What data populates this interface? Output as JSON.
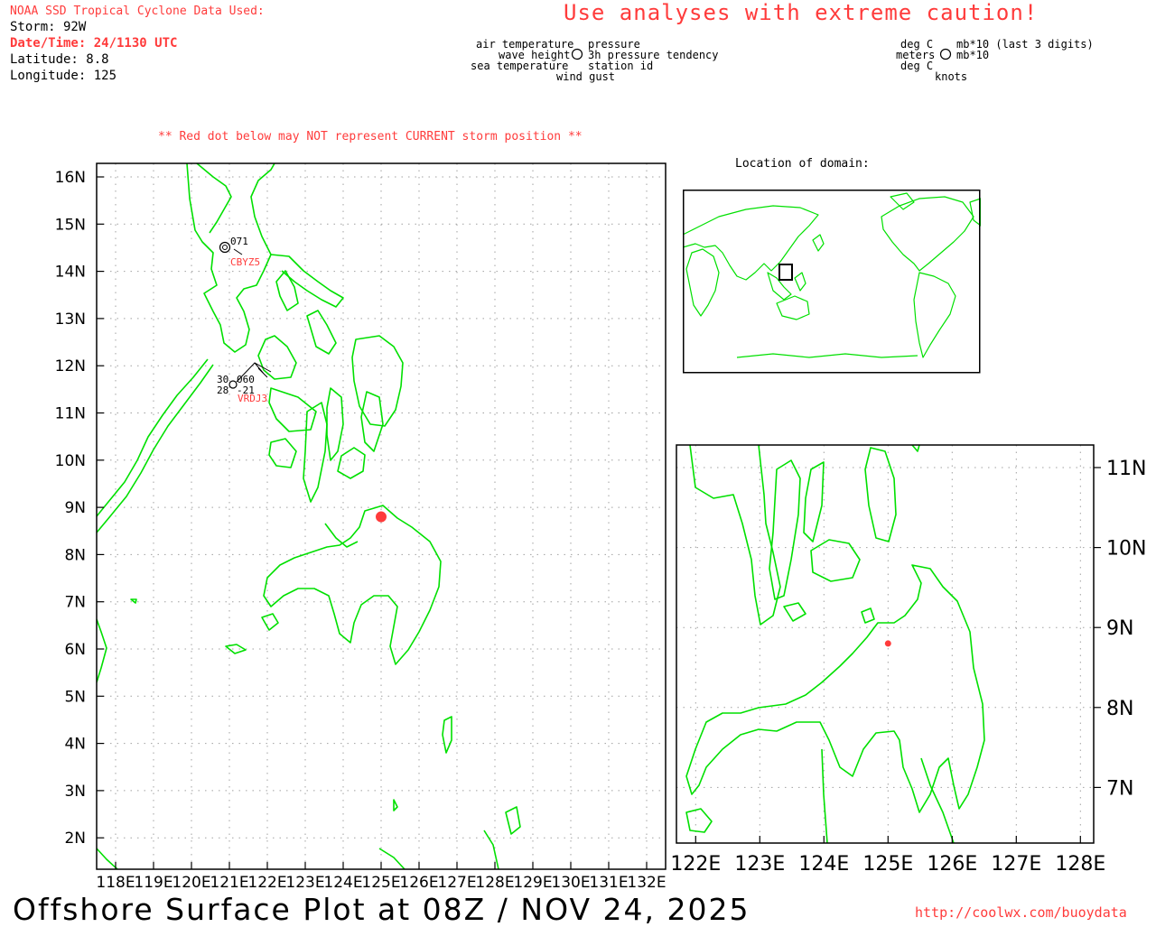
{
  "header": {
    "source_title": "NOAA SSD Tropical Cyclone Data Used:",
    "storm": "Storm: 92W",
    "datetime": "Date/Time: 24/1130 UTC",
    "latitude": "Latitude: 8.8",
    "longitude": "Longitude: 125",
    "caution": "Use analyses with extreme caution!",
    "red_dot_note": "** Red dot below may NOT represent CURRENT storm position **"
  },
  "legend": {
    "left": {
      "air_temperature": "air temperature",
      "wave_height": "wave height",
      "sea_temperature": "sea temperature",
      "pressure": "pressure",
      "pressure_tendency": "3h pressure tendency",
      "station_id": "station id",
      "wind_gust": "wind gust"
    },
    "right": {
      "deg_c_top": "deg C",
      "meters": "meters",
      "deg_c_bottom": "deg C",
      "mb10_last3": "mb*10 (last 3 digits)",
      "mb10": "mb*10",
      "knots": "knots"
    }
  },
  "inset": {
    "title": "Location of domain:"
  },
  "main_map": {
    "lat_labels": [
      "16N",
      "15N",
      "14N",
      "13N",
      "12N",
      "11N",
      "10N",
      "9N",
      "8N",
      "7N",
      "6N",
      "5N",
      "4N",
      "3N",
      "2N"
    ],
    "lon_labels": [
      "118E",
      "119E",
      "120E",
      "121E",
      "122E",
      "123E",
      "124E",
      "125E",
      "126E",
      "127E",
      "128E",
      "129E",
      "130E",
      "131E",
      "132E"
    ],
    "stations": [
      {
        "id": "CBYZ5",
        "pressure": "071"
      },
      {
        "id": "VRDJ3",
        "air_temp": "30",
        "sea_temp": "28",
        "pressure": "060",
        "tendency": "-21"
      }
    ],
    "storm_marker": {
      "lat": 8.8,
      "lon": 125,
      "color": "#ff3b3b"
    }
  },
  "zoom_map": {
    "lat_labels": [
      "11N",
      "10N",
      "9N",
      "8N",
      "7N"
    ],
    "lon_labels": [
      "122E",
      "123E",
      "124E",
      "125E",
      "126E",
      "127E",
      "128E"
    ]
  },
  "footer": {
    "title": "Offshore Surface Plot at 08Z / NOV 24, 2025",
    "url": "http://coolwx.com/buoydata"
  },
  "colors": {
    "coastline": "#00e000",
    "accent_red": "#ff3b3b",
    "grid": "#a0a0a0"
  }
}
